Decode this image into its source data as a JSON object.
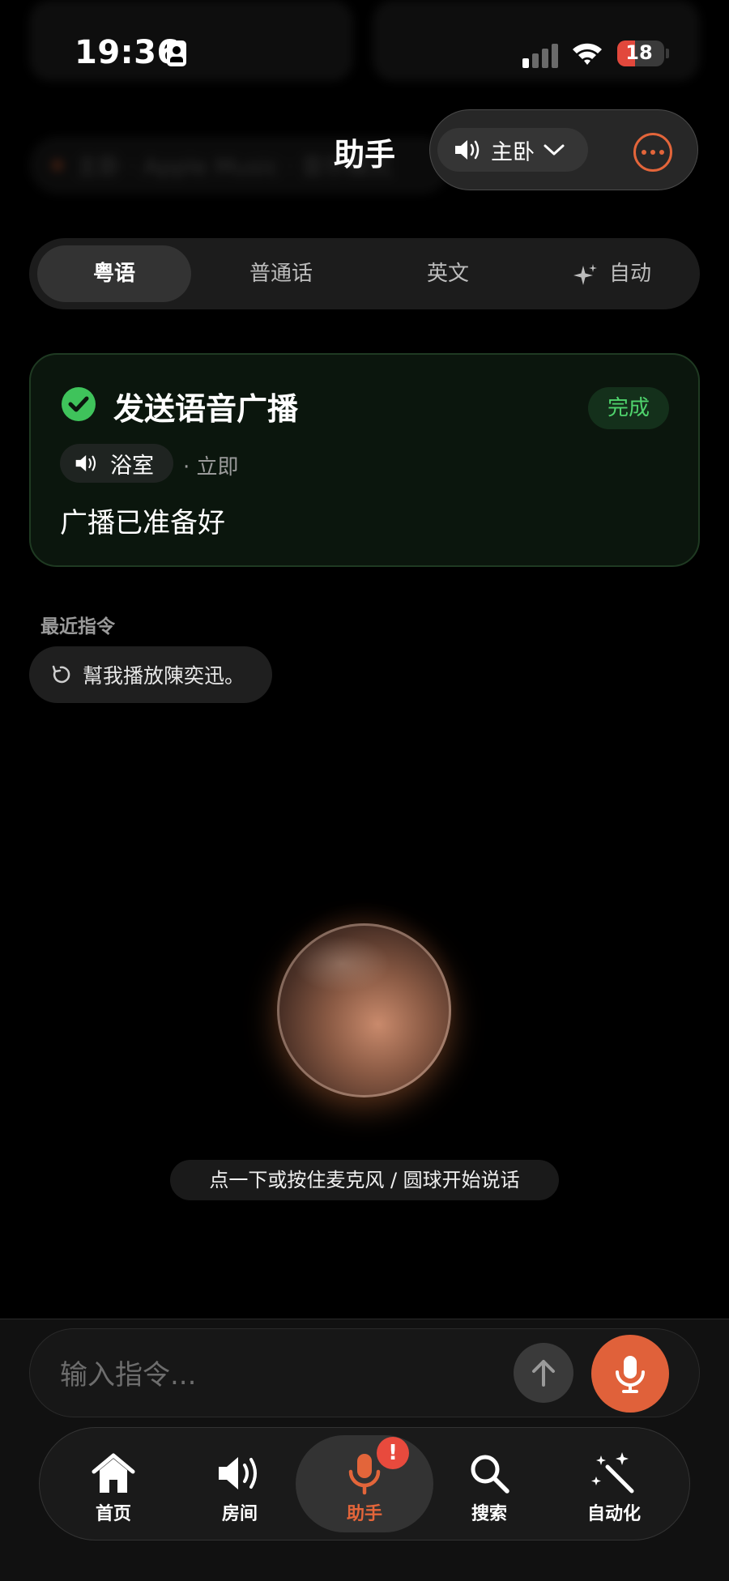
{
  "status_bar": {
    "time": "19:36",
    "battery": "18"
  },
  "header": {
    "title": "助手",
    "room_selector": "主卧"
  },
  "background_ghost": {
    "text": "主卧 · Apple Music · 音乐模式"
  },
  "languages": [
    {
      "label": "粤语",
      "active": true
    },
    {
      "label": "普通话",
      "active": false
    },
    {
      "label": "英文",
      "active": false
    },
    {
      "label": "自动",
      "active": false
    }
  ],
  "result_card": {
    "title": "发送语音广播",
    "status": "完成",
    "room": "浴室",
    "timing": "· 立即",
    "message": "广播已准备好"
  },
  "recent": {
    "heading": "最近指令",
    "items": [
      {
        "text": "幫我播放陳奕迅。"
      }
    ]
  },
  "hint": "点一下或按住麦克风 / 圆球开始说话",
  "input": {
    "placeholder": "输入指令..."
  },
  "tabs": [
    {
      "label": "首页",
      "icon": "home-icon",
      "active": false
    },
    {
      "label": "房间",
      "icon": "speaker-icon",
      "active": false
    },
    {
      "label": "助手",
      "icon": "mic-icon",
      "active": true,
      "badge": "!"
    },
    {
      "label": "搜索",
      "icon": "search-icon",
      "active": false
    },
    {
      "label": "自动化",
      "icon": "magic-wand-icon",
      "active": false
    }
  ],
  "colors": {
    "accent": "#e0613a",
    "success": "#3fc35b",
    "background": "#000000"
  }
}
